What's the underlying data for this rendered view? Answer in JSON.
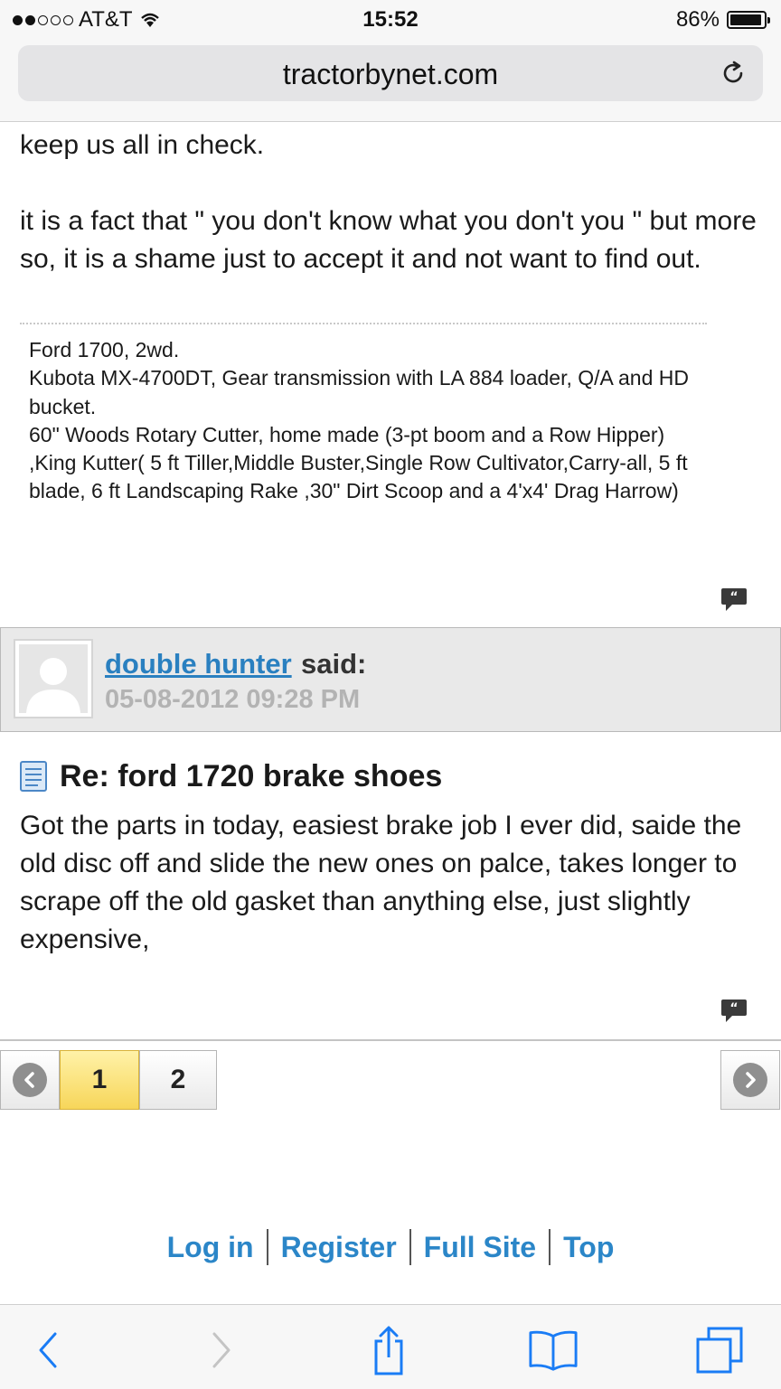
{
  "status_bar": {
    "carrier": "AT&T",
    "time": "15:52",
    "battery": "86%"
  },
  "browser": {
    "url": "tractorbynet.com"
  },
  "previous_post": {
    "text_line1": "keep us all in check.",
    "text_para2": "it is a fact that \" you don't know what you don't you \" but more so, it is a shame just to accept it and not want to find out.",
    "signature": [
      "Ford 1700, 2wd.",
      "Kubota MX-4700DT, Gear transmission with LA 884 loader, Q/A and HD bucket.",
      "60\" Woods Rotary Cutter, home made (3-pt boom and a Row Hipper) ,King Kutter( 5 ft Tiller,Middle Buster,Single Row Cultivator,Carry-all, 5 ft blade, 6 ft Landscaping Rake ,30\" Dirt Scoop and a 4'x4' Drag Harrow)"
    ]
  },
  "post": {
    "username": "double hunter",
    "said": "said:",
    "date": "05-08-2012 09:28 PM",
    "title": "Re: ford 1720 brake shoes",
    "body": "Got the parts in today, easiest brake job I ever did, saide the old disc off and slide the new ones on palce, takes longer to scrape off the old gasket than anything else, just slightly expensive,"
  },
  "pagination": {
    "pages": [
      "1",
      "2"
    ],
    "current": "1"
  },
  "footer": {
    "login": "Log in",
    "register": "Register",
    "full_site": "Full Site",
    "top": "Top"
  },
  "colors": {
    "link": "#2b86c8",
    "current_page": "#f7d65a",
    "ios_blue": "#1a7cf5"
  }
}
